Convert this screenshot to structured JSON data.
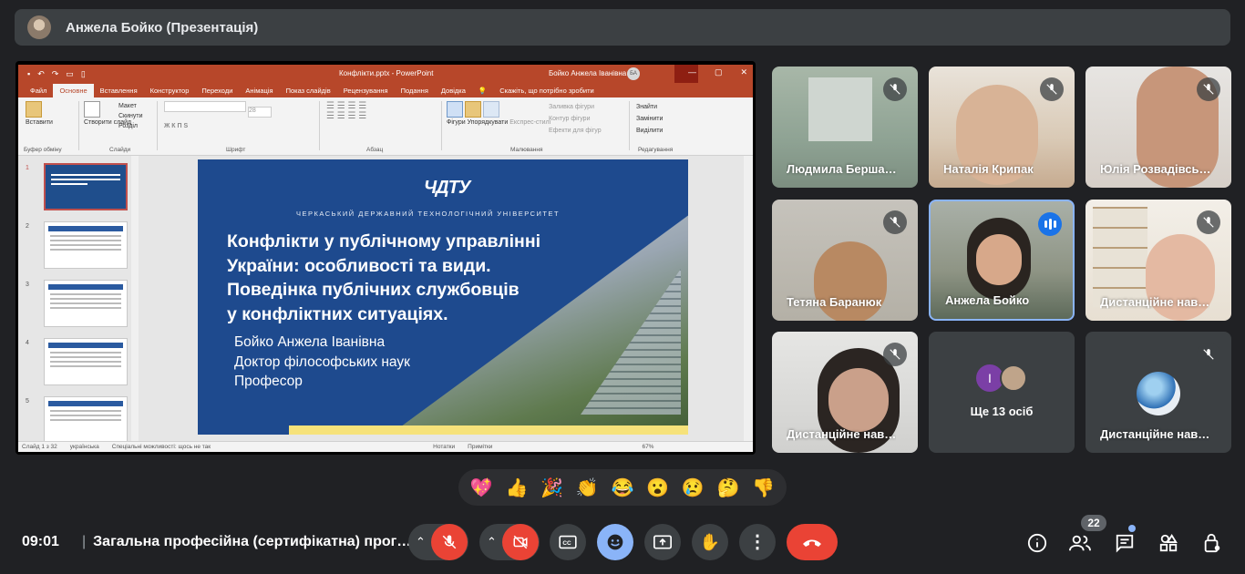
{
  "presenter_bar": {
    "title": "Анжела Бойко (Презентація)"
  },
  "powerpoint": {
    "doc_title": "Конфлікти.pptx  -  PowerPoint",
    "user_name": "Бойко Анжела Іванівна",
    "user_initials": "БА",
    "tabs": [
      "Файл",
      "Основне",
      "Вставлення",
      "Конструктор",
      "Переходи",
      "Анімація",
      "Показ слайдів",
      "Рецензування",
      "Подання",
      "Довідка"
    ],
    "tell_me": "Скажіть, що потрібно зробити",
    "ribbon": {
      "paste": "Вставити",
      "clipboard": "Буфер обміну",
      "new_slide": "Створити слайд",
      "layout": "Макет",
      "reset": "Скинути",
      "section": "Розділ",
      "slides": "Слайди",
      "font_size": "28",
      "font": "Шрифт",
      "paragraph": "Абзац",
      "shapes": "Фігури",
      "arrange": "Упорядкувати",
      "quick_styles": "Експрес-стилі",
      "shape_fill": "Заливка фігури",
      "shape_outline": "Контур фігури",
      "shape_effects": "Ефекти для фігур",
      "drawing": "Малювання",
      "find": "Знайти",
      "replace": "Замінити",
      "select": "Виділити",
      "editing": "Редагування"
    },
    "slide_numbers": [
      "1",
      "2",
      "3",
      "4",
      "5"
    ],
    "slide": {
      "logo": "ЧДТУ",
      "university": "ЧЕРКАСЬКИЙ ДЕРЖАВНИЙ ТЕХНОЛОГІЧНИЙ УНІВЕРСИТЕТ",
      "heading_lines": [
        "Конфлікти у публічному управлінні",
        "України: особливості та види.",
        "Поведінка публічних службовців",
        "у конфліктних ситуаціях."
      ],
      "author_lines": [
        "Бойко Анжела Іванівна",
        "Доктор філософських наук",
        "Професор"
      ]
    },
    "status": {
      "slide_of": "Слайд 1 з 32",
      "language": "українська",
      "accessibility": "Спеціальні можливості: щось не так",
      "notes": "Нотатки",
      "comments": "Примітки",
      "zoom": "67%"
    }
  },
  "participants": [
    {
      "name": "Людмила Берша…",
      "muted": true
    },
    {
      "name": "Наталія Крипак",
      "muted": true
    },
    {
      "name": "Юлія Розвадівсь…",
      "muted": true
    },
    {
      "name": "Тетяна Баранюк",
      "muted": true
    },
    {
      "name": "Анжела Бойко",
      "muted": false,
      "speaking": true
    },
    {
      "name": "Дистанційне нав…",
      "muted": true
    },
    {
      "name": "Дистанційне нав…",
      "muted": true
    },
    {
      "name": "Ще 13 осіб",
      "avatar_letter": "І"
    },
    {
      "name": "Дистанційне нав…",
      "muted": true
    }
  ],
  "reactions": [
    "💖",
    "👍",
    "🎉",
    "👏",
    "😂",
    "😮",
    "😢",
    "🤔",
    "👎"
  ],
  "bottom_bar": {
    "time": "09:01",
    "meeting_title": "Загальна професійна (сертифікатна) прог…",
    "participants_count": "22"
  },
  "colors": {
    "background": "#202124",
    "panel": "#3c4043",
    "end_call": "#ea4335",
    "accent": "#8ab4f8",
    "ppt_red": "#b7472a",
    "slide_blue": "#1e4a8e"
  }
}
